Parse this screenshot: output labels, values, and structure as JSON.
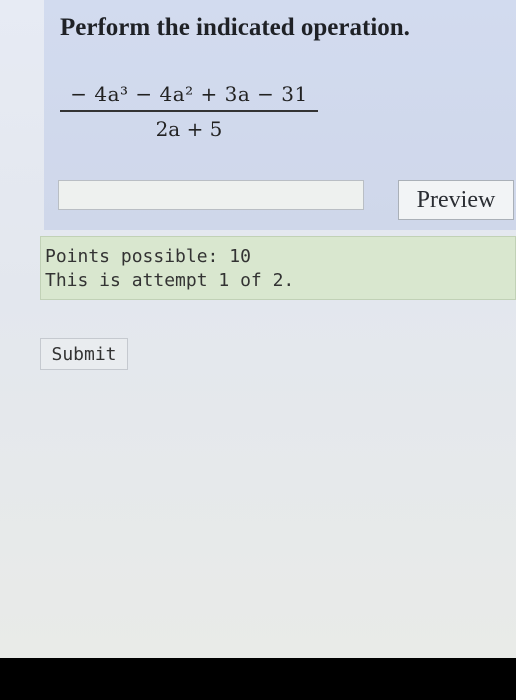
{
  "question": {
    "prompt": "Perform the indicated operation.",
    "numerator": "− 4a³ − 4a² + 3a − 31",
    "denominator": "2a + 5"
  },
  "answer": {
    "value": "",
    "preview_label": "Preview"
  },
  "info": {
    "points": "Points possible: 10",
    "attempt": "This is attempt 1 of 2."
  },
  "actions": {
    "submit_label": "Submit"
  }
}
